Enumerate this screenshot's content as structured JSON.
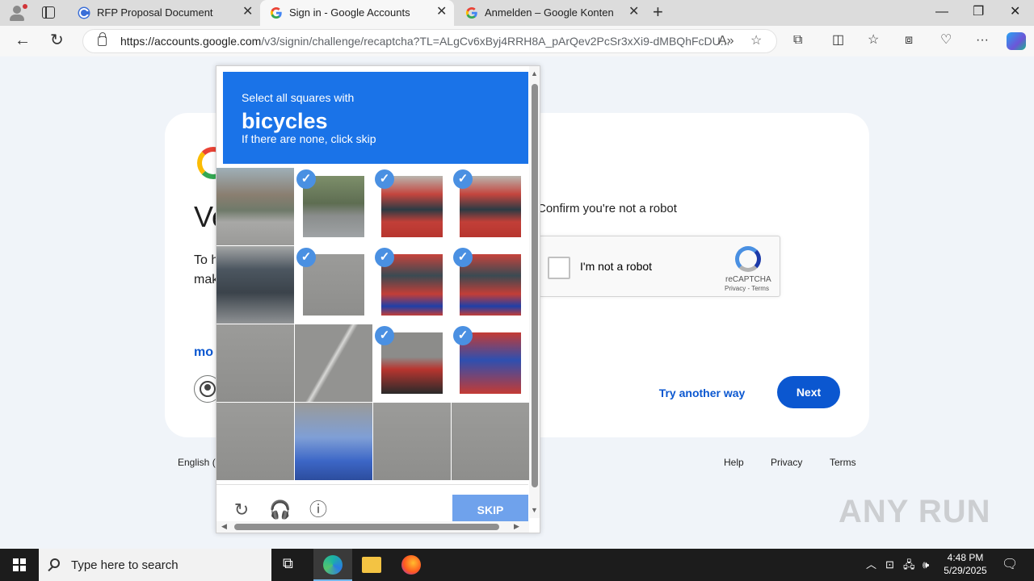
{
  "browser": {
    "tabs": [
      {
        "title": "RFP Proposal Document",
        "favicon": "c-circle-icon",
        "active": false
      },
      {
        "title": "Sign in - Google Accounts",
        "favicon": "google-g-icon",
        "active": true
      },
      {
        "title": "Anmelden – Google Konten",
        "favicon": "google-g-icon",
        "active": false
      }
    ],
    "url_host": "https://accounts.google.com",
    "url_path": "/v3/signin/challenge/recaptcha?TL=ALgCv6xByj4RRH8A_pArQev2PcSr3xXi9-dMBQhFcDU..."
  },
  "page": {
    "heading_partial": "Ve",
    "text_partial_1": "To h",
    "text_partial_2": "mak",
    "link_partial": "mo",
    "confirm_text": "Confirm you're not a robot",
    "recaptcha_label": "I'm not a robot",
    "recaptcha_brand": "reCAPTCHA",
    "recaptcha_terms": "Privacy - Terms",
    "try_another_way": "Try another way",
    "next": "Next",
    "footer_lang": "English (",
    "footer_help": "Help",
    "footer_privacy": "Privacy",
    "footer_terms": "Terms"
  },
  "challenge": {
    "line1": "Select all squares with",
    "keyword": "bicycles",
    "line3": "If there are none, click skip",
    "skip": "SKIP",
    "tiles": [
      {
        "selected": false,
        "scene": "street-cyclist"
      },
      {
        "selected": true,
        "scene": "street-cars"
      },
      {
        "selected": true,
        "scene": "bus-top"
      },
      {
        "selected": true,
        "scene": "bus-top"
      },
      {
        "selected": false,
        "scene": "car-front"
      },
      {
        "selected": true,
        "scene": "road"
      },
      {
        "selected": true,
        "scene": "bus-side"
      },
      {
        "selected": true,
        "scene": "bus-side"
      },
      {
        "selected": false,
        "scene": "road"
      },
      {
        "selected": false,
        "scene": "road-line"
      },
      {
        "selected": true,
        "scene": "road-bus"
      },
      {
        "selected": true,
        "scene": "bus-sign"
      },
      {
        "selected": false,
        "scene": "road"
      },
      {
        "selected": false,
        "scene": "car-roof"
      },
      {
        "selected": false,
        "scene": "road"
      },
      {
        "selected": false,
        "scene": "road"
      }
    ]
  },
  "watermark": "ANY RUN",
  "taskbar": {
    "search_placeholder": "Type here to search",
    "time": "4:48 PM",
    "date": "5/29/2025"
  }
}
